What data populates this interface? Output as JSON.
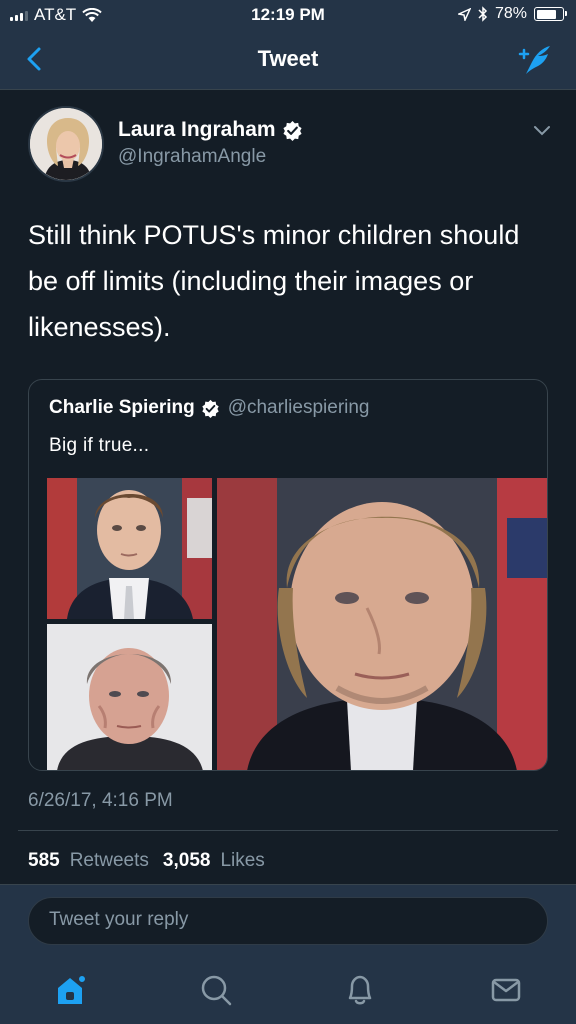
{
  "status_bar": {
    "carrier": "AT&T",
    "time": "12:19 PM",
    "battery": "78%",
    "battery_level": 0.78
  },
  "nav": {
    "title": "Tweet",
    "icons": [
      "back-chevron-icon",
      "compose-tweet-icon"
    ]
  },
  "tweet": {
    "author_name": "Laura Ingraham",
    "author_handle": "@IngrahamAngle",
    "text": "Still think POTUS's minor children should be off limits (including their images or likenesses).",
    "timestamp": "6/26/17, 4:16 PM",
    "retweets_count": "585",
    "retweets_label": "Retweets",
    "likes_count": "3,058",
    "likes_label": "Likes"
  },
  "quoted_tweet": {
    "author_name": "Charlie Spiering",
    "author_handle": "@charliespiering",
    "text": "Big if true..."
  },
  "reply": {
    "placeholder": "Tweet your reply"
  },
  "tab_bar": {
    "icons": [
      "home-icon",
      "search-icon",
      "notifications-icon",
      "messages-icon"
    ],
    "active": "home-icon"
  },
  "colors": {
    "background": "#141d26",
    "bar": "#243447",
    "accent": "#1da1f2",
    "secondary_text": "#8899a6"
  }
}
